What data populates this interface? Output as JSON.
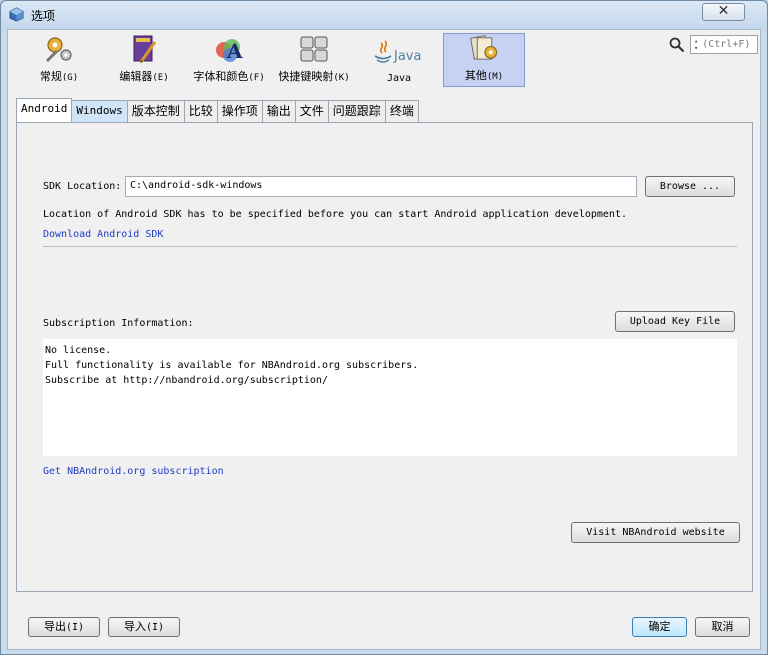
{
  "window": {
    "title": "选项",
    "close_label": "✕"
  },
  "categories": [
    {
      "label": "常规",
      "shortcut": "(G)",
      "icon": "gears-icon"
    },
    {
      "label": "编辑器",
      "shortcut": "(E)",
      "icon": "editor-icon"
    },
    {
      "label": "字体和颜色",
      "shortcut": "(F)",
      "icon": "font-color-icon"
    },
    {
      "label": "快捷键映射",
      "shortcut": "(K)",
      "icon": "keyboard-icon"
    },
    {
      "label": "Java",
      "shortcut": "",
      "icon": "java-icon"
    },
    {
      "label": "其他",
      "shortcut": "(M)",
      "icon": "misc-icon"
    }
  ],
  "search": {
    "placeholder": "(Ctrl+F)"
  },
  "tabs": [
    "Android",
    "Windows",
    "版本控制",
    "比较",
    "操作项",
    "输出",
    "文件",
    "问题跟踪",
    "终端"
  ],
  "active_tab": "Android",
  "android": {
    "sdk_label": "SDK Location:",
    "sdk_value": "C:\\android-sdk-windows",
    "browse_label": "Browse ...",
    "location_note": "Location of Android SDK has to be specified before you can start Android application development.",
    "download_link": "Download Android SDK",
    "subscription_label": "Subscription Information:",
    "upload_label": "Upload Key File",
    "subscription_lines": [
      "No license.",
      "Full functionality is available for NBAndroid.org subscribers.",
      "Subscribe at http://nbandroid.org/subscription/"
    ],
    "get_subscription_link": "Get NBAndroid.org subscription",
    "visit_label": "Visit NBAndroid website"
  },
  "footer": {
    "export_label": "导出",
    "export_shortcut": "(I)",
    "import_label": "导入",
    "import_shortcut": "(I)",
    "ok_label": "确定",
    "cancel_label": "取消"
  },
  "colors": {
    "link": "#1f3cc1",
    "active_category": "#c7d2f2",
    "window_frame": "#c9daea"
  }
}
